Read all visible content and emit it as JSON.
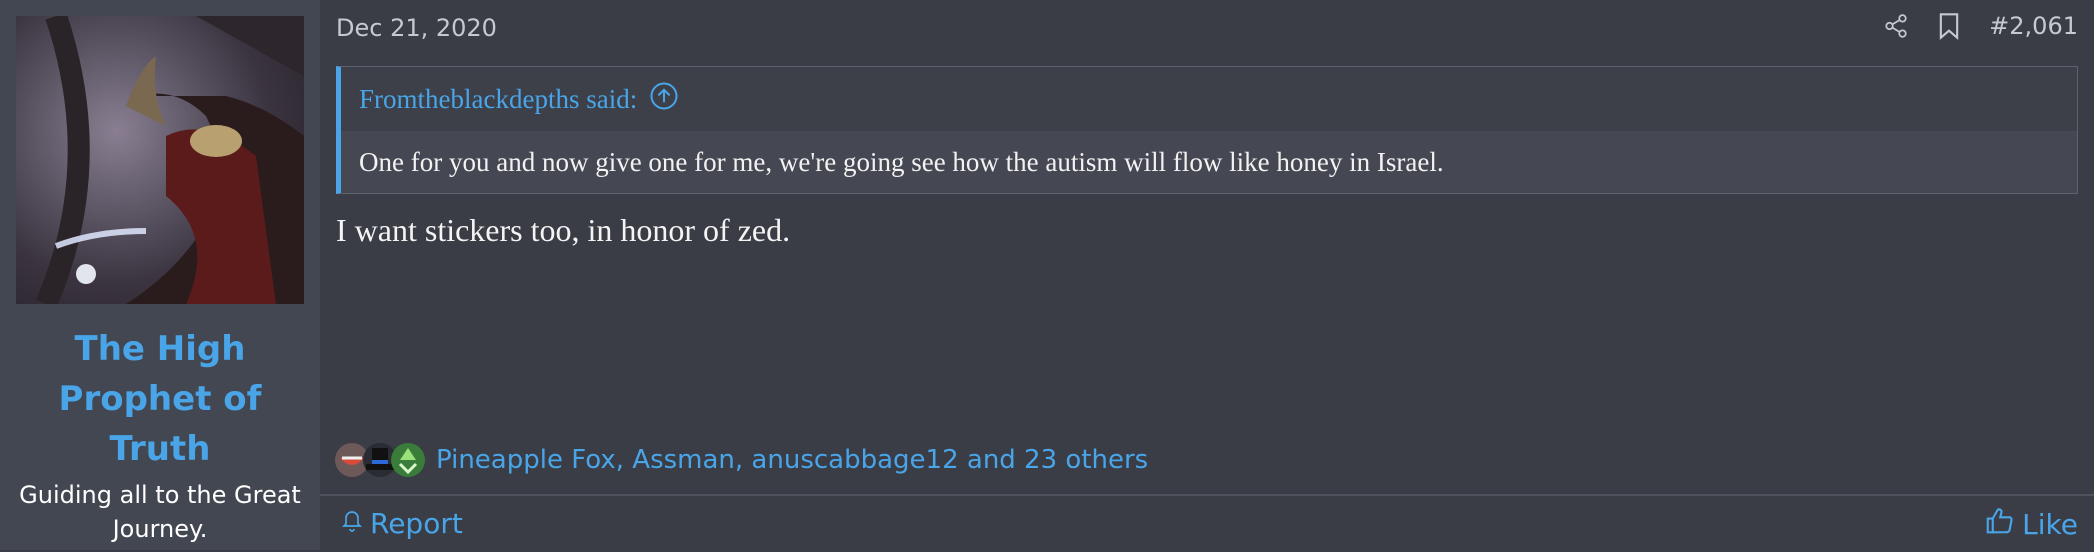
{
  "user": {
    "avatar_alt": "user avatar",
    "name": "The High Prophet of Truth",
    "title": "Guiding all to the Great Journey."
  },
  "post": {
    "date": "Dec 21, 2020",
    "number": "#2,061",
    "icons": {
      "share": "share-icon",
      "bookmark": "bookmark-icon"
    }
  },
  "quote": {
    "author": "Fromtheblackdepths said:",
    "text": "One for you and now give one for me, we're going see how the autism will flow like honey in Israel."
  },
  "message": {
    "text": "I want stickers too, in honor of zed."
  },
  "reactions": {
    "summary": "Pineapple Fox, Assman, anuscabbage12 and 23 others",
    "icons": [
      "laugh-reaction-icon",
      "hat-reaction-icon",
      "recycle-reaction-icon"
    ]
  },
  "footer": {
    "report": "Report",
    "like": "Like"
  },
  "colors": {
    "accent": "#49a5e8",
    "background": "#3a3d46",
    "sidebar": "#434751"
  }
}
